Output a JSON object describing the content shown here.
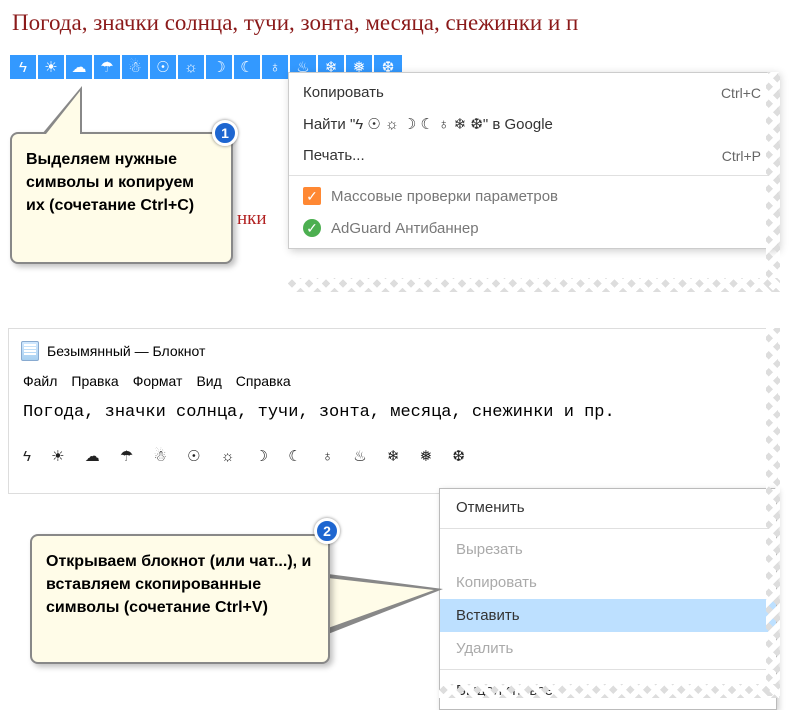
{
  "title": "Погода, значки солнца, тучи, зонта, месяца, снежинки и п",
  "weather_icons": [
    "ϟ",
    "☀",
    "☁",
    "☂",
    "☃",
    "☉",
    "☼",
    "☽",
    "☾",
    "♁",
    "♨",
    "❄",
    "❅",
    "❆"
  ],
  "ctx1": {
    "copy_label": "Копировать",
    "copy_shortcut": "Ctrl+C",
    "find_label": "Найти \"ϟ    ☉ ☼ ☽ ☾ ♁  ❄ ❆\" в Google",
    "print_label": "Печать...",
    "print_shortcut": "Ctrl+P",
    "ext1_label": "Массовые проверки параметров",
    "ext2_label": "AdGuard Антибаннер"
  },
  "callout1_text": "Выделяем нужные символы и копируем их (сочетание Ctrl+C)",
  "badge1": "1",
  "red_fragment": "нки",
  "notepad": {
    "title": "Безымянный — Блокнот",
    "menus": [
      "Файл",
      "Правка",
      "Формат",
      "Вид",
      "Справка"
    ],
    "content_line": "Погода, значки солнца, тучи, зонта, месяца, снежинки и пр.",
    "symbols_line": "ϟ ☀ ☁ ☂ ☃ ☉ ☼ ☽ ☾ ♁ ♨ ❄ ❅ ❆"
  },
  "ctx2": {
    "undo": "Отменить",
    "cut": "Вырезать",
    "copy": "Копировать",
    "paste": "Вставить",
    "delete": "Удалить",
    "selectall": "Выделить все"
  },
  "callout2_text": "Открываем блокнот (или чат...), и вставляем скопированные символы (сочетание Ctrl+V)",
  "badge2": "2"
}
